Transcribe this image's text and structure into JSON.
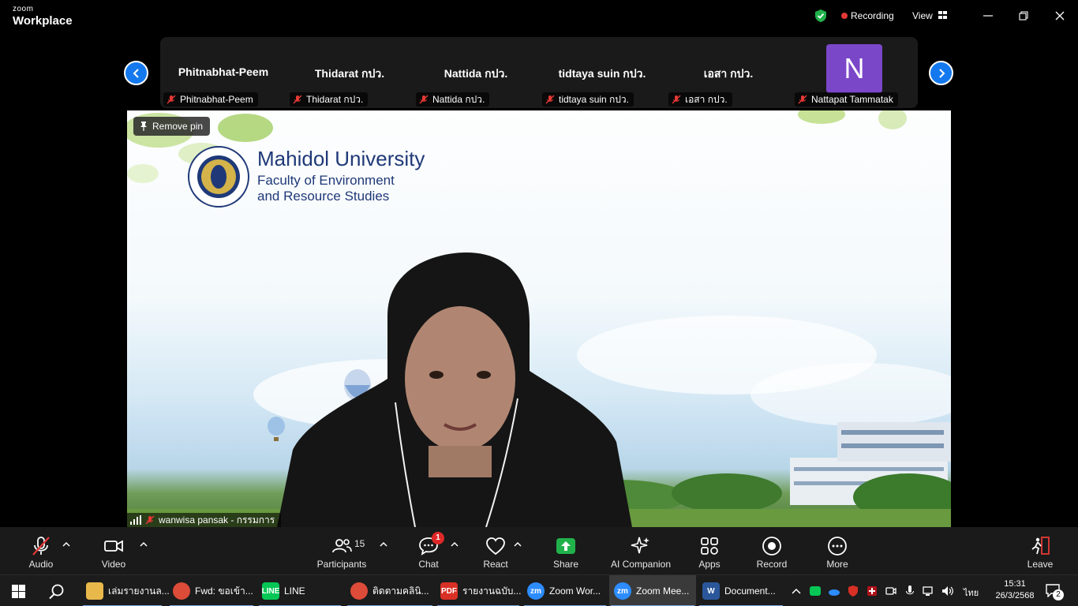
{
  "app": {
    "brand_small": "zoom",
    "brand_big": "Workplace",
    "recording_label": "Recording",
    "view_label": "View"
  },
  "strip": {
    "tiles": [
      {
        "name": "Phitnabhat-Peem",
        "label": "Phitnabhat-Peem"
      },
      {
        "name": "Thidarat กปว.",
        "label": "Thidarat กปว."
      },
      {
        "name": "Nattida กปว.",
        "label": "Nattida กปว."
      },
      {
        "name": "tidtaya suin กปว.",
        "label": "tidtaya suin กปว."
      },
      {
        "name": "เอสา กปว.",
        "label": "เอสา กปว."
      },
      {
        "avatar": "N",
        "label": "Nattapat Tammatak"
      }
    ]
  },
  "main": {
    "remove_pin": "Remove pin",
    "university": "Mahidol University",
    "faculty_line1": "Faculty of Environment",
    "faculty_line2": "and Resource Studies",
    "speaker": "wanwisa pansak - กรรมการ"
  },
  "toolbar": {
    "audio": "Audio",
    "video": "Video",
    "participants": "Participants",
    "participants_count": "15",
    "chat": "Chat",
    "chat_badge": "1",
    "react": "React",
    "share": "Share",
    "ai_companion": "AI Companion",
    "apps": "Apps",
    "record": "Record",
    "more": "More",
    "leave": "Leave"
  },
  "taskbar": {
    "apps": [
      {
        "label": "เล่มรายงานล...",
        "icon": "folder-icon",
        "color": "#e8b84a"
      },
      {
        "label": "Fwd: ขอเข้า...",
        "icon": "chrome-icon",
        "color": "#dd4b39"
      },
      {
        "label": "LINE",
        "icon": "line-icon",
        "color": "#06c755"
      },
      {
        "label": "ติดตามคลินิ...",
        "icon": "chrome-icon",
        "color": "#dd4b39"
      },
      {
        "label": "รายงานฉบับ...",
        "icon": "pdf-icon",
        "color": "#d93025"
      },
      {
        "label": "Zoom Wor...",
        "icon": "zoom-icon",
        "color": "#2d8cff"
      },
      {
        "label": "Zoom Mee...",
        "icon": "zoom-icon",
        "color": "#2d8cff"
      },
      {
        "label": "Document...",
        "icon": "word-icon",
        "color": "#2b579a"
      }
    ],
    "lang": "ไทย",
    "time": "15:31",
    "date": "26/3/2568",
    "notif_count": "2"
  }
}
